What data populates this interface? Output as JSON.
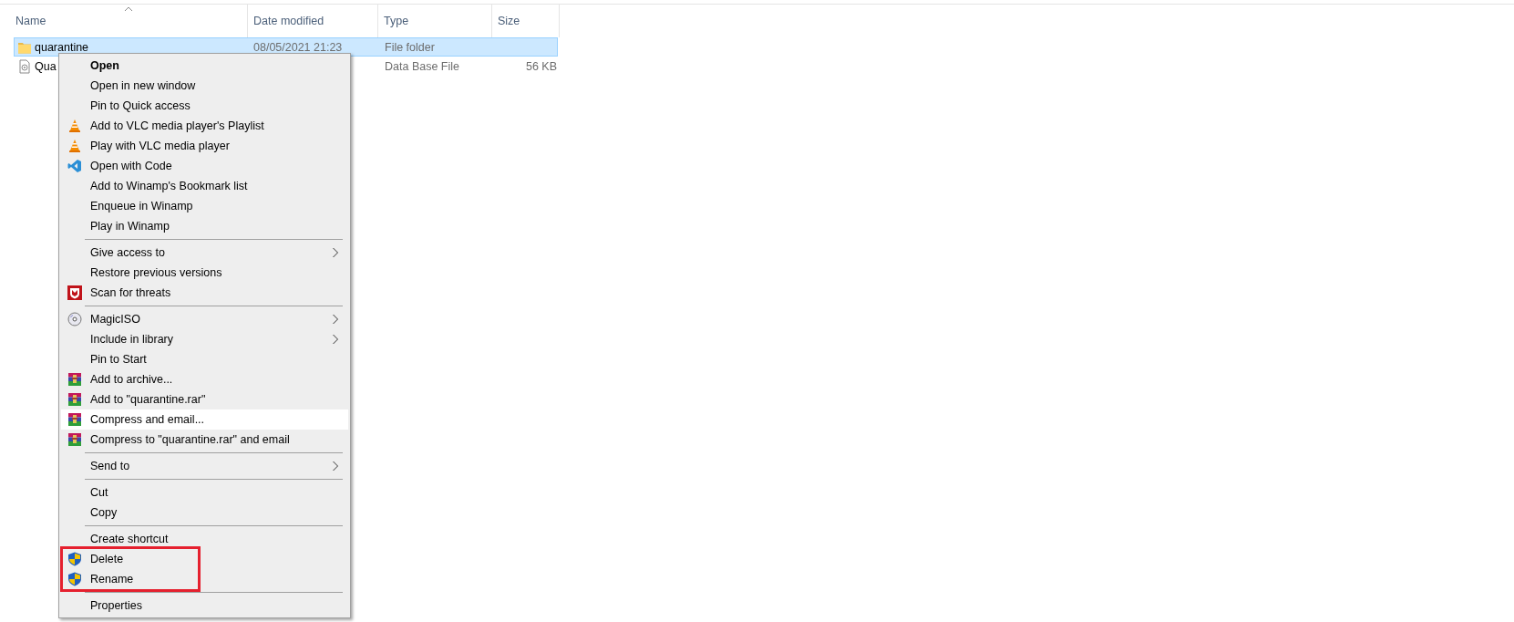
{
  "columns": [
    {
      "label": "Name",
      "sorted": true
    },
    {
      "label": "Date modified",
      "sorted": false
    },
    {
      "label": "Type",
      "sorted": false
    },
    {
      "label": "Size",
      "sorted": false
    }
  ],
  "rows": [
    {
      "kind": "folder",
      "name": "quarantine",
      "date_modified": "08/05/2021 21:23",
      "type": "File folder",
      "selected": true
    },
    {
      "kind": "file",
      "name": "Qua",
      "type": "Data Base File",
      "size": "56 KB",
      "selected": false
    }
  ],
  "context_menu": {
    "items": [
      {
        "kind": "item",
        "label": "Open",
        "default": true,
        "submenu": false,
        "hovered": false,
        "annotated": false
      },
      {
        "kind": "item",
        "label": "Open in new window",
        "default": false,
        "submenu": false,
        "hovered": false,
        "annotated": false
      },
      {
        "kind": "item",
        "label": "Pin to Quick access",
        "default": false,
        "submenu": false,
        "hovered": false,
        "annotated": false
      },
      {
        "kind": "item",
        "label": "Add to VLC media player's Playlist",
        "default": false,
        "submenu": false,
        "hovered": false,
        "annotated": false
      },
      {
        "kind": "item",
        "label": "Play with VLC media player",
        "default": false,
        "submenu": false,
        "hovered": false,
        "annotated": false
      },
      {
        "kind": "item",
        "label": "Open with Code",
        "default": false,
        "submenu": false,
        "hovered": false,
        "annotated": false
      },
      {
        "kind": "item",
        "label": "Add to Winamp's Bookmark list",
        "default": false,
        "submenu": false,
        "hovered": false,
        "annotated": false
      },
      {
        "kind": "item",
        "label": "Enqueue in Winamp",
        "default": false,
        "submenu": false,
        "hovered": false,
        "annotated": false
      },
      {
        "kind": "item",
        "label": "Play in Winamp",
        "default": false,
        "submenu": false,
        "hovered": false,
        "annotated": false
      },
      {
        "kind": "separator"
      },
      {
        "kind": "item",
        "label": "Give access to",
        "default": false,
        "submenu": true,
        "hovered": false,
        "annotated": false
      },
      {
        "kind": "item",
        "label": "Restore previous versions",
        "default": false,
        "submenu": false,
        "hovered": false,
        "annotated": false
      },
      {
        "kind": "item",
        "label": "Scan for threats",
        "default": false,
        "submenu": false,
        "hovered": false,
        "annotated": false
      },
      {
        "kind": "separator"
      },
      {
        "kind": "item",
        "label": "MagicISO",
        "default": false,
        "submenu": true,
        "hovered": false,
        "annotated": false
      },
      {
        "kind": "item",
        "label": "Include in library",
        "default": false,
        "submenu": true,
        "hovered": false,
        "annotated": false
      },
      {
        "kind": "item",
        "label": "Pin to Start",
        "default": false,
        "submenu": false,
        "hovered": false,
        "annotated": false
      },
      {
        "kind": "item",
        "label": "Add to archive...",
        "default": false,
        "submenu": false,
        "hovered": false,
        "annotated": false
      },
      {
        "kind": "item",
        "label": "Add to \"quarantine.rar\"",
        "default": false,
        "submenu": false,
        "hovered": false,
        "annotated": false
      },
      {
        "kind": "item",
        "label": "Compress and email...",
        "default": false,
        "submenu": false,
        "hovered": true,
        "annotated": false
      },
      {
        "kind": "item",
        "label": "Compress to \"quarantine.rar\" and email",
        "default": false,
        "submenu": false,
        "hovered": false,
        "annotated": false
      },
      {
        "kind": "separator"
      },
      {
        "kind": "item",
        "label": "Send to",
        "default": false,
        "submenu": true,
        "hovered": false,
        "annotated": false
      },
      {
        "kind": "separator"
      },
      {
        "kind": "item",
        "label": "Cut",
        "default": false,
        "submenu": false,
        "hovered": false,
        "annotated": false
      },
      {
        "kind": "item",
        "label": "Copy",
        "default": false,
        "submenu": false,
        "hovered": false,
        "annotated": false
      },
      {
        "kind": "separator"
      },
      {
        "kind": "item",
        "label": "Create shortcut",
        "default": false,
        "submenu": false,
        "hovered": false,
        "annotated": false
      },
      {
        "kind": "item",
        "label": "Delete",
        "default": false,
        "submenu": false,
        "hovered": false,
        "annotated": true
      },
      {
        "kind": "item",
        "label": "Rename",
        "default": false,
        "submenu": false,
        "hovered": false,
        "annotated": true
      },
      {
        "kind": "separator"
      },
      {
        "kind": "item",
        "label": "Properties",
        "default": false,
        "submenu": false,
        "hovered": false,
        "annotated": false
      }
    ]
  }
}
